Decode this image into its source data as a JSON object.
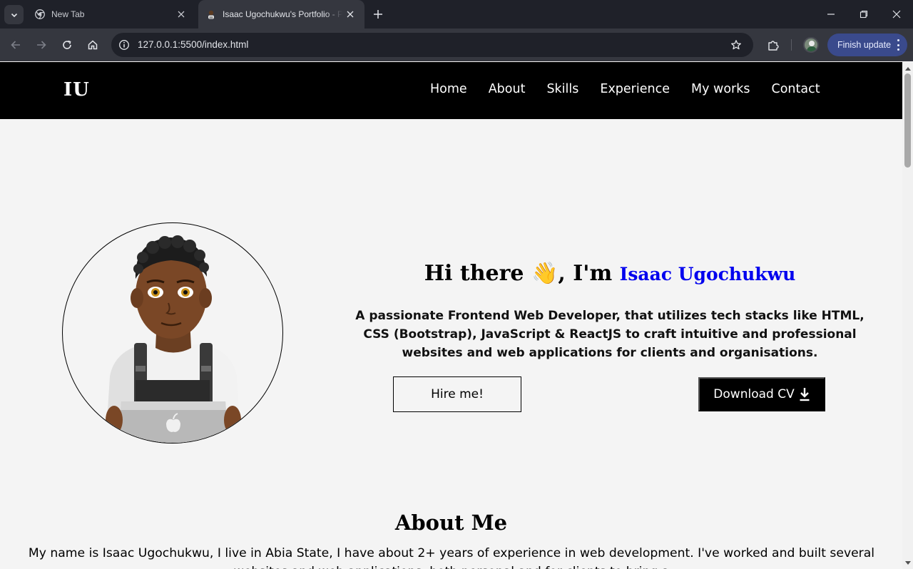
{
  "browser": {
    "tabs": [
      {
        "title": "New Tab",
        "active": false
      },
      {
        "title": "Isaac Ugochukwu's Portfolio - Portfolio",
        "active": true
      }
    ],
    "url": "127.0.0.1:5500/index.html",
    "finish_update_label": "Finish update",
    "icons": [
      "tab-search-icon",
      "chrome-icon",
      "close-icon",
      "plus-icon",
      "minimize-icon",
      "restore-icon",
      "back-arrow-icon",
      "forward-arrow-icon",
      "reload-icon",
      "home-icon",
      "site-info-icon",
      "star-icon",
      "extensions-icon",
      "kebab-menu-icon"
    ]
  },
  "site": {
    "logo": "IU",
    "nav": [
      "Home",
      "About",
      "Skills",
      "Experience",
      "My works",
      "Contact"
    ],
    "hero": {
      "greeting": "Hi there",
      "wave_emoji": "👋",
      "im": ", I'm",
      "name": "Isaac Ugochukwu",
      "description": "A passionate Frontend Web Developer, that utilizes tech stacks like HTML, CSS (Bootstrap), JavaScript & ReactJS to craft intuitive and professional websites and web applications for clients and organisations.",
      "hire_label": "Hire me!",
      "cv_label": "Download CV"
    },
    "about": {
      "title": "About Me",
      "text": "My name is Isaac Ugochukwu, I live in Abia State, I have about 2+ years of experience in web development. I've worked and built several websites and web applications, both personal and for clients to bring a"
    }
  },
  "colors": {
    "tabstrip": "#1f2129",
    "toolbar": "#35373f",
    "accent_name": "#0000ee",
    "finish_update_bg": "#3a4a8c"
  }
}
